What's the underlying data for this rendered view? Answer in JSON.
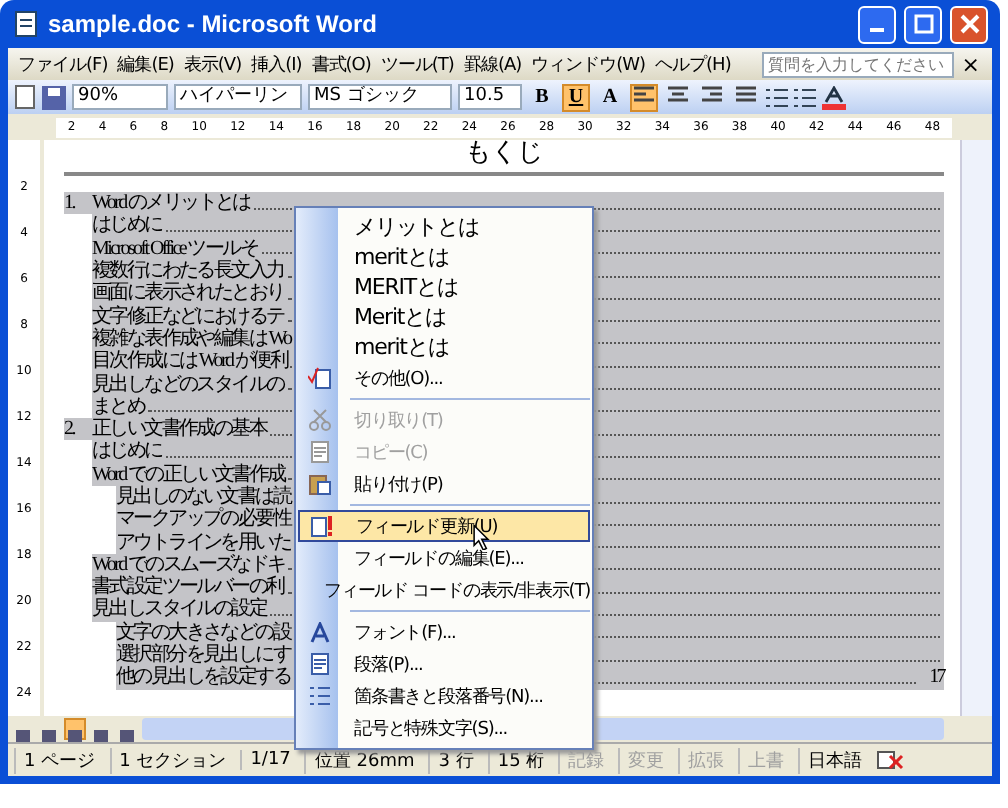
{
  "window": {
    "title": "sample.doc - Microsoft Word"
  },
  "menu_bar": {
    "items": [
      "ファイル(F)",
      "編集(E)",
      "表示(V)",
      "挿入(I)",
      "書式(O)",
      "ツール(T)",
      "罫線(A)",
      "ウィンドウ(W)",
      "ヘルプ(H)"
    ],
    "help_placeholder": "質問を入力してください",
    "close": "×"
  },
  "toolbar": {
    "zoom": "90%",
    "style": "ハイパーリン",
    "font": "MS ゴシック",
    "size": "10.5",
    "format_buttons": [
      {
        "label": "B",
        "selected": false
      },
      {
        "label": "U",
        "selected": true
      },
      {
        "label": "A",
        "selected": false
      }
    ],
    "align_buttons": [
      {
        "kind": "left",
        "selected": true
      },
      {
        "kind": "center",
        "selected": false
      },
      {
        "kind": "right",
        "selected": false
      },
      {
        "kind": "justify",
        "selected": false
      }
    ]
  },
  "ruler": {
    "ticks": [
      "2",
      "4",
      "6",
      "8",
      "10",
      "12",
      "14",
      "16",
      "18",
      "20",
      "22",
      "24",
      "26",
      "28",
      "30",
      "32",
      "34",
      "36",
      "38",
      "40",
      "42",
      "44",
      "46",
      "48"
    ],
    "vertical_ticks": [
      "2",
      "4",
      "6",
      "8",
      "10",
      "12",
      "14",
      "16",
      "18",
      "20",
      "22",
      "24"
    ]
  },
  "document": {
    "title": "もくじ",
    "toc": [
      {
        "number": "1.",
        "text": "Word のメリットとは",
        "children": [
          {
            "text": "はじめに"
          },
          {
            "text": "Microsoft Office ツールそ"
          },
          {
            "text": "複数行にわたる長文入力"
          },
          {
            "text": "画面に表示されたとおり"
          },
          {
            "text": "文字修正などにおけるテ"
          },
          {
            "text": "複雑な表作成や編集は Wo"
          },
          {
            "text": "目次作成には Word が便利"
          },
          {
            "text": "見出しなどのスタイルの"
          },
          {
            "text": "まとめ"
          }
        ]
      },
      {
        "number": "2.",
        "text": "正しい文書作成の基本",
        "children": [
          {
            "text": "はじめに"
          },
          {
            "text": "Word での正しい文書作成",
            "children": [
              {
                "text": "見出しのない文書は読"
              },
              {
                "text": "マークアップの必要性"
              },
              {
                "text": "アウトラインを用いた"
              }
            ]
          },
          {
            "text": "Word でのスムーズなドキ"
          },
          {
            "text": "書式設定ツールバーの利"
          },
          {
            "text": "見出しスタイルの設定",
            "children": [
              {
                "text": "文字の大きさなどの設"
              },
              {
                "text": "選択部分を見出しにす"
              },
              {
                "text": "他の見出しを設定する",
                "page": "17"
              }
            ]
          }
        ]
      }
    ]
  },
  "context_menu": [
    {
      "kind": "suggestion",
      "label": "メリットとは",
      "disabled": false,
      "selected": false
    },
    {
      "kind": "suggestion",
      "label": "meritとは",
      "disabled": false,
      "selected": false
    },
    {
      "kind": "suggestion",
      "label": "MERITとは",
      "disabled": false,
      "selected": false
    },
    {
      "kind": "suggestion",
      "label": "Meritとは",
      "disabled": false,
      "selected": false
    },
    {
      "kind": "suggestion",
      "label": "meritとは",
      "disabled": false,
      "selected": false
    },
    {
      "kind": "command",
      "label": "その他(O)...",
      "disabled": false,
      "selected": false
    },
    {
      "kind": "separator"
    },
    {
      "kind": "command",
      "label": "切り取り(T)",
      "disabled": true,
      "selected": false
    },
    {
      "kind": "command",
      "label": "コピー(C)",
      "disabled": true,
      "selected": false
    },
    {
      "kind": "command",
      "label": "貼り付け(P)",
      "disabled": false,
      "selected": false
    },
    {
      "kind": "separator"
    },
    {
      "kind": "command",
      "label": "フィールド更新(U)",
      "disabled": false,
      "selected": true
    },
    {
      "kind": "command",
      "label": "フィールドの編集(E)...",
      "disabled": false,
      "selected": false
    },
    {
      "kind": "command",
      "label": "フィールド コードの表示/非表示(T)",
      "disabled": false,
      "selected": false
    },
    {
      "kind": "separator"
    },
    {
      "kind": "command",
      "label": "フォント(F)...",
      "disabled": false,
      "selected": false
    },
    {
      "kind": "command",
      "label": "段落(P)...",
      "disabled": false,
      "selected": false
    },
    {
      "kind": "command",
      "label": "箇条書きと段落番号(N)...",
      "disabled": false,
      "selected": false
    },
    {
      "kind": "command",
      "label": "記号と特殊文字(S)...",
      "disabled": false,
      "selected": false
    }
  ],
  "view_buttons": [
    {
      "selected": false
    },
    {
      "selected": false
    },
    {
      "selected": true
    },
    {
      "selected": false
    },
    {
      "selected": false
    }
  ],
  "status_bar": [
    {
      "label": "1 ページ",
      "disabled": false
    },
    {
      "label": "1 セクション",
      "disabled": false
    },
    {
      "label": "1/17",
      "disabled": false
    },
    {
      "label": "位置 26mm",
      "disabled": false
    },
    {
      "label": "3 行",
      "disabled": false
    },
    {
      "label": "15 桁",
      "disabled": false
    },
    {
      "label": "記録",
      "disabled": true
    },
    {
      "label": "変更",
      "disabled": true
    },
    {
      "label": "拡張",
      "disabled": true
    },
    {
      "label": "上書",
      "disabled": true
    },
    {
      "label": "日本語",
      "disabled": false
    }
  ]
}
